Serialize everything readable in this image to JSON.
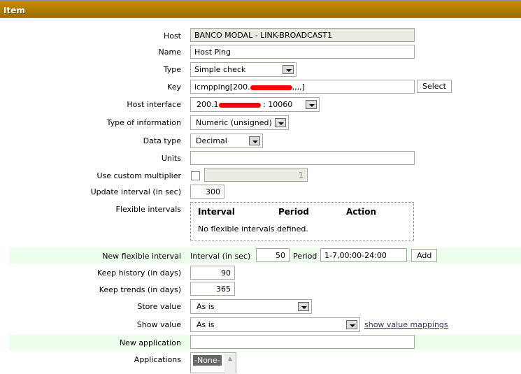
{
  "header": {
    "title": "Item"
  },
  "form": {
    "host": {
      "label": "Host",
      "value": "BANCO MODAL - LINK-BROADCAST1"
    },
    "name": {
      "label": "Name",
      "value": "Host Ping"
    },
    "type": {
      "label": "Type",
      "value": "Simple check"
    },
    "key": {
      "label": "Key",
      "value_prefix": "icmpping[200.",
      "value_suffix": ",,,,]",
      "select": "Select"
    },
    "host_interface": {
      "label": "Host interface",
      "value_prefix": "200.1",
      "value_suffix": ": 10060"
    },
    "type_of_information": {
      "label": "Type of information",
      "value": "Numeric (unsigned)"
    },
    "data_type": {
      "label": "Data type",
      "value": "Decimal"
    },
    "units": {
      "label": "Units",
      "value": ""
    },
    "custom_multiplier": {
      "label": "Use custom multiplier",
      "value": "1"
    },
    "update_interval": {
      "label": "Update interval (in sec)",
      "value": "300"
    },
    "flexible_intervals": {
      "label": "Flexible intervals",
      "columns": [
        "Interval",
        "Period",
        "Action"
      ],
      "empty": "No flexible intervals defined."
    },
    "new_flexible_interval": {
      "label": "New flexible interval",
      "interval_label": "Interval (in sec)",
      "interval_value": "50",
      "period_label": "Period",
      "period_value": "1-7,00:00-24:00",
      "add": "Add"
    },
    "keep_history": {
      "label": "Keep history (in days)",
      "value": "90"
    },
    "keep_trends": {
      "label": "Keep trends (in days)",
      "value": "365"
    },
    "store_value": {
      "label": "Store value",
      "value": "As is"
    },
    "show_value": {
      "label": "Show value",
      "value": "As is",
      "link": "show value mappings"
    },
    "new_application": {
      "label": "New application",
      "value": ""
    },
    "applications": {
      "label": "Applications",
      "selected": "-None-"
    }
  }
}
